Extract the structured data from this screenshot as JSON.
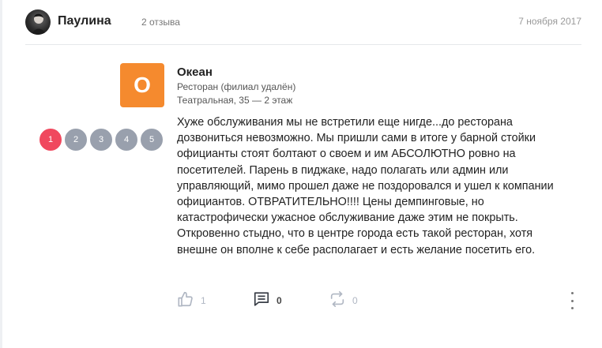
{
  "author": {
    "name": "Паулина",
    "reviews": "2 отзыва",
    "date": "7 ноября 2017"
  },
  "place": {
    "logo_letter": "О",
    "name": "Океан",
    "type": "Ресторан (филиал удалён)",
    "address": "Театральная, 35 — 2 этаж",
    "logo_color": "#f58a2e"
  },
  "rating": {
    "value": 1,
    "labels": [
      "1",
      "2",
      "3",
      "4",
      "5"
    ],
    "active_color": "#f0485e",
    "inactive_color": "#99a0ad"
  },
  "review": {
    "text": "Хуже обслуживания мы не встретили еще нигде...до ресторана дозвониться невозможно. Мы пришли сами в итоге у барной стойки официанты стоят болтают о своем и им АБСОЛЮТНО ровно на посетителей. Парень в пиджаке, надо полагать или админ или управляющий, мимо прошел даже не поздоровался и ушел к компании официантов. ОТВРАТИТЕЛЬНО!!!! Цены демпинговые, но катастрофически ужасное обслуживание даже этим не покрыть. Откровенно стыдно, что в центре города есть такой ресторан, хотя внешне он вполне к себе располагает и есть желание посетить его."
  },
  "actions": {
    "likes": "1",
    "like_icon": "thumbs-up-icon",
    "comments": "0",
    "comment_icon": "comment-icon",
    "reposts": "0",
    "repost_icon": "repost-icon",
    "more_icon": "more-vertical-icon"
  }
}
